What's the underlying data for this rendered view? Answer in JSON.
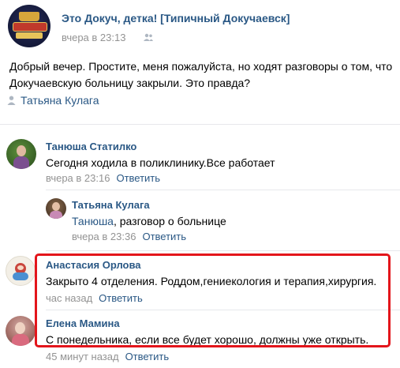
{
  "post": {
    "group_name": "Это Докуч, детка! [Типичный Докучаевск]",
    "time": "вчера в 23:13",
    "text": "Добрый вечер. Простите, меня пожалуйста, но ходят разговоры о том, что Докучаевскую больницу закрыли. Это правда?",
    "author": "Татьяна Кулага"
  },
  "comments": [
    {
      "name": "Танюша Статилко",
      "text": "Сегодня ходила в поликлинику.Все работает",
      "time": "вчера в 23:16",
      "reply": "Ответить"
    },
    {
      "name": "Татьяна Кулага",
      "mention": "Танюша",
      "text": ", разговор о больнице",
      "time": "вчера в 23:36",
      "reply": "Ответить"
    },
    {
      "name": "Анастасия Орлова",
      "text": "Закрыто 4 отделения. Роддом,гениекология и терапия,хирургия.",
      "time": "час назад",
      "reply": "Ответить"
    },
    {
      "name": "Елена Мамина",
      "text": "С понедельника, если все будет хорошо, должны уже открыть.",
      "time": "45 минут назад",
      "reply": "Ответить"
    }
  ],
  "colors": {
    "link": "#2a5885",
    "meta": "#939393",
    "highlight": "#e3151b",
    "divider": "#e7e8ec"
  }
}
